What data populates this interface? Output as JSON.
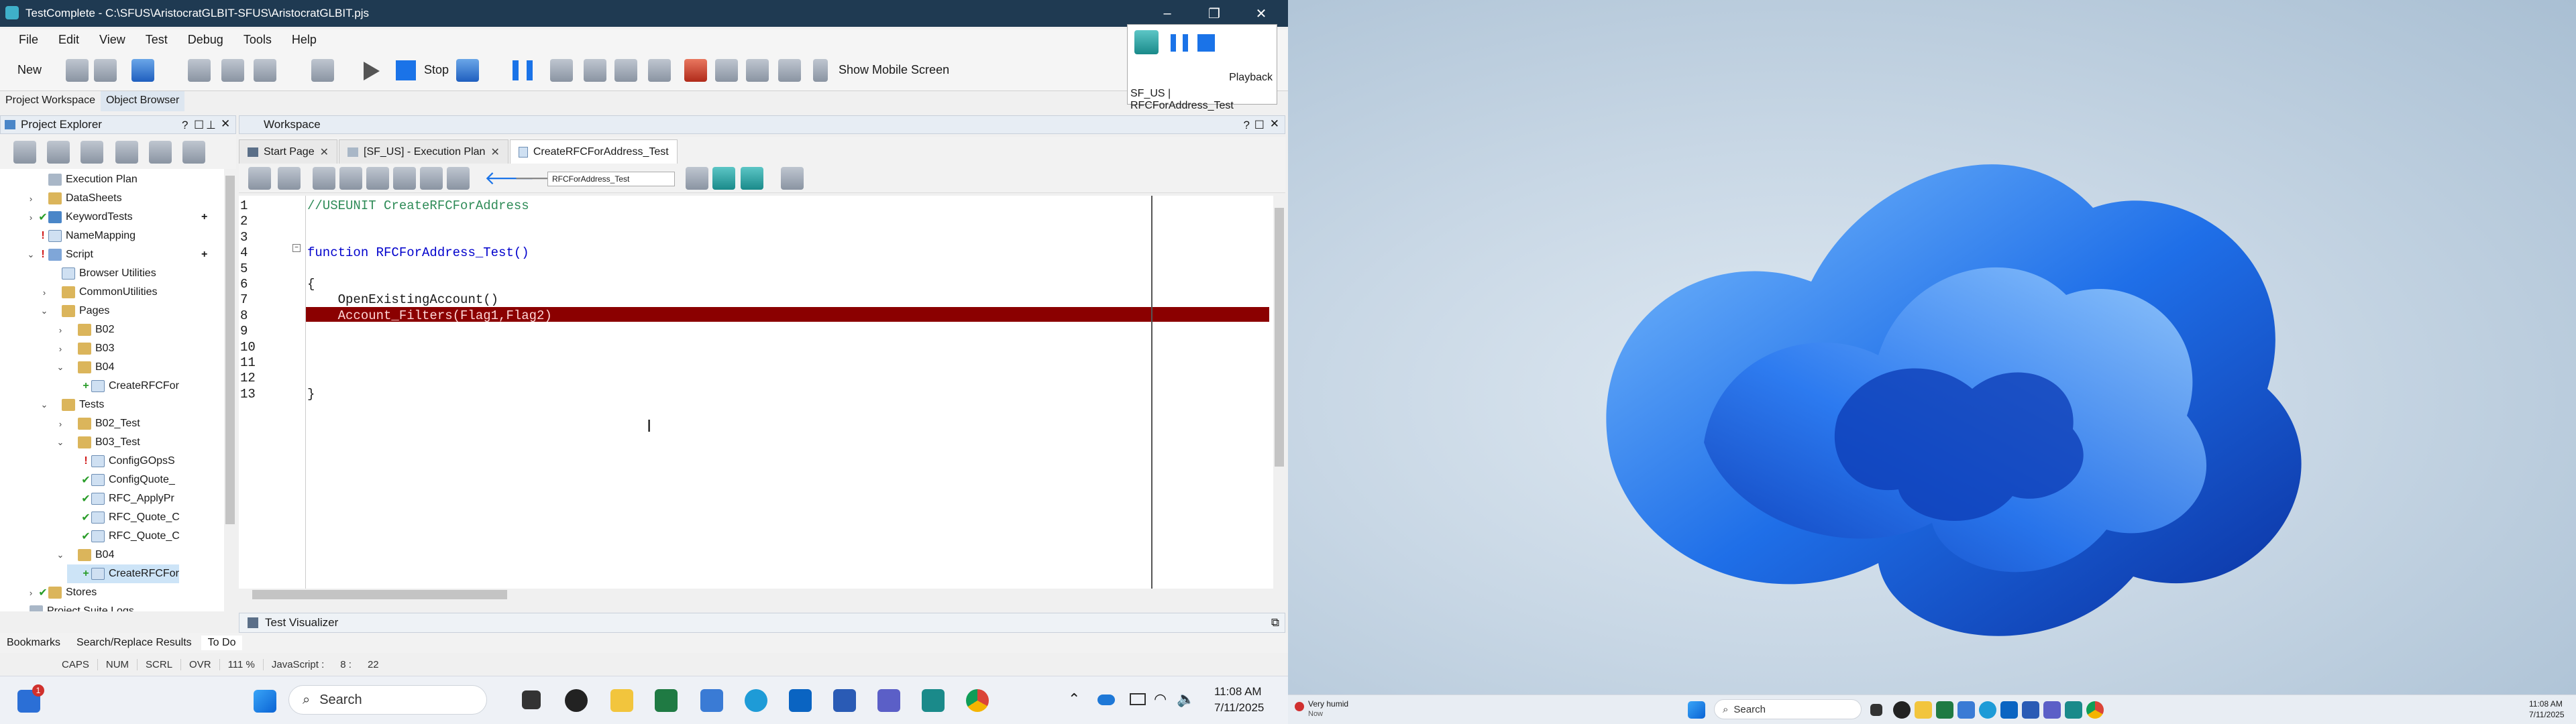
{
  "window": {
    "title": "TestComplete - C:\\SFUS\\AristocratGLBIT-SFUS\\AristocratGLBIT.pjs",
    "controls": [
      "–",
      "❐",
      "✕"
    ]
  },
  "menu": [
    "File",
    "Edit",
    "View",
    "Test",
    "Debug",
    "Tools",
    "Help"
  ],
  "toolbar": {
    "new_label": "New",
    "stop_label": "Stop",
    "mobile_label": "Show Mobile Screen"
  },
  "playback": {
    "label": "Playback",
    "context": "SF_US | RFCForAddress_Test"
  },
  "left_tabs": [
    "Project Workspace",
    "Object Browser"
  ],
  "project_explorer": {
    "title": "Project Explorer",
    "tree": [
      {
        "label": "Execution Plan",
        "depth": 1,
        "caret": "",
        "mark": "",
        "icon": "grid"
      },
      {
        "label": "DataSheets",
        "depth": 1,
        "caret": "›",
        "mark": "",
        "icon": "folder"
      },
      {
        "label": "KeywordTests",
        "depth": 1,
        "caret": "›",
        "mark": "✔",
        "icon": "kw",
        "add": "+"
      },
      {
        "label": "NameMapping",
        "depth": 1,
        "caret": "",
        "mark": "!",
        "icon": "file"
      },
      {
        "label": "Script",
        "depth": 1,
        "caret": "⌄",
        "mark": "!",
        "icon": "script",
        "add": "+"
      },
      {
        "label": "Browser Utilities",
        "depth": 2,
        "caret": "",
        "mark": "",
        "icon": "file"
      },
      {
        "label": "CommonUtilities",
        "depth": 2,
        "caret": "›",
        "mark": "",
        "icon": "folder"
      },
      {
        "label": "Pages",
        "depth": 2,
        "caret": "⌄",
        "mark": "",
        "icon": "folder"
      },
      {
        "label": "B02",
        "depth": 3,
        "caret": "›",
        "mark": "",
        "icon": "folder"
      },
      {
        "label": "B03",
        "depth": 3,
        "caret": "›",
        "mark": "",
        "icon": "folder"
      },
      {
        "label": "B04",
        "depth": 3,
        "caret": "⌄",
        "mark": "",
        "icon": "folder"
      },
      {
        "label": "CreateRFCFor",
        "depth": 4,
        "caret": "",
        "mark": "+",
        "icon": "file"
      },
      {
        "label": "Tests",
        "depth": 2,
        "caret": "⌄",
        "mark": "",
        "icon": "folder"
      },
      {
        "label": "B02_Test",
        "depth": 3,
        "caret": "›",
        "mark": "",
        "icon": "folder"
      },
      {
        "label": "B03_Test",
        "depth": 3,
        "caret": "⌄",
        "mark": "",
        "icon": "folder"
      },
      {
        "label": "ConfigGOpsS",
        "depth": 4,
        "caret": "",
        "mark": "!",
        "icon": "file"
      },
      {
        "label": "ConfigQuote_",
        "depth": 4,
        "caret": "",
        "mark": "✔",
        "icon": "file"
      },
      {
        "label": "RFC_ApplyPr",
        "depth": 4,
        "caret": "",
        "mark": "✔",
        "icon": "file"
      },
      {
        "label": "RFC_Quote_C",
        "depth": 4,
        "caret": "",
        "mark": "✔",
        "icon": "file"
      },
      {
        "label": "RFC_Quote_C",
        "depth": 4,
        "caret": "",
        "mark": "✔",
        "icon": "file"
      },
      {
        "label": "B04",
        "depth": 3,
        "caret": "⌄",
        "mark": "",
        "icon": "folder"
      },
      {
        "label": "CreateRFCFor",
        "depth": 4,
        "caret": "",
        "mark": "+",
        "icon": "file",
        "selected": true
      },
      {
        "label": "Stores",
        "depth": 1,
        "caret": "›",
        "mark": "✔",
        "icon": "folder"
      },
      {
        "label": "Project Suite Logs",
        "depth": 0,
        "caret": "⌄",
        "mark": "",
        "icon": "grid"
      }
    ]
  },
  "workspace": {
    "title": "Workspace",
    "tabs": [
      {
        "label": "Start Page",
        "active": false
      },
      {
        "label": "[SF_US] - Execution Plan",
        "active": false
      },
      {
        "label": "CreateRFCForAddress_Test",
        "active": true
      }
    ],
    "routine_select": "RFCForAddress_Test"
  },
  "editor": {
    "lines": [
      {
        "n": "1",
        "text": "//USEUNIT CreateRFCForAddress",
        "kind": "comment"
      },
      {
        "n": "2",
        "text": "",
        "kind": "plain"
      },
      {
        "n": "3",
        "text": "",
        "kind": "plain"
      },
      {
        "n": "4",
        "text": "function RFCForAddress_Test()",
        "kind": "func"
      },
      {
        "n": "5",
        "text": "",
        "kind": "plain"
      },
      {
        "n": "6",
        "text": "{",
        "kind": "plain"
      },
      {
        "n": "7",
        "text": "    OpenExistingAccount()",
        "kind": "plain"
      },
      {
        "n": "8",
        "text": "    Account_Filters(Flag1,Flag2)",
        "kind": "error"
      },
      {
        "n": "9",
        "text": "",
        "kind": "plain"
      },
      {
        "n": "10",
        "text": "",
        "kind": "plain"
      },
      {
        "n": "11",
        "text": "",
        "kind": "plain"
      },
      {
        "n": "12",
        "text": "",
        "kind": "plain"
      },
      {
        "n": "13",
        "text": "}",
        "kind": "plain"
      }
    ],
    "colors": {
      "error_bg": "#8b0000",
      "comment": "#2e8b57",
      "keyword": "#0000cc"
    }
  },
  "test_visualizer": {
    "title": "Test Visualizer"
  },
  "bottom_tabs": [
    "Bookmarks",
    "Search/Replace Results",
    "To Do"
  ],
  "status": [
    "CAPS",
    "NUM",
    "SCRL",
    "OVR",
    "111 %",
    "JavaScript :",
    "8 :",
    "22"
  ],
  "taskbar": {
    "search_label": "Search",
    "time": "11:08 AM",
    "date": "7/11/2025",
    "notification_count": "1"
  },
  "taskbar2": {
    "weather": "Very humid",
    "weather_sub": "Now",
    "search_label": "Search",
    "time": "11:08 AM",
    "date": "7/11/2025"
  }
}
